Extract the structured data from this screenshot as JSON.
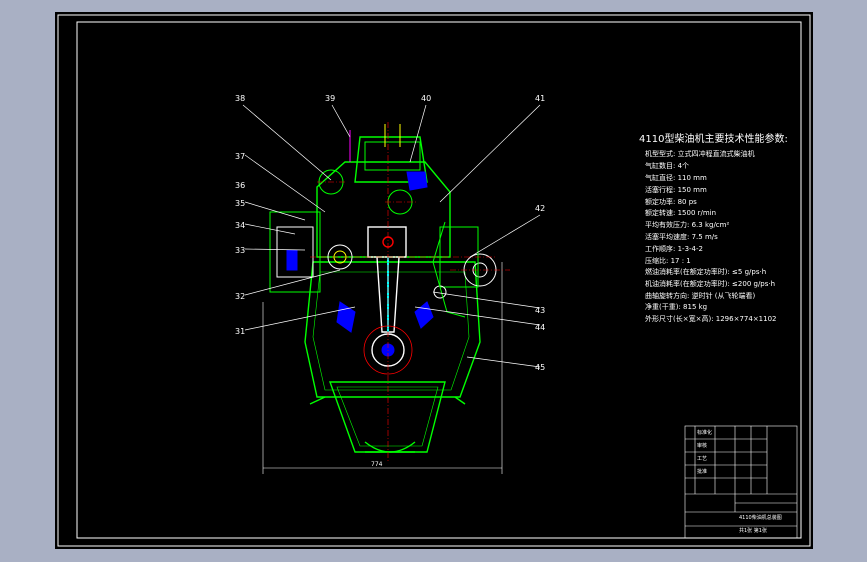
{
  "callouts": [
    "31",
    "32",
    "33",
    "34",
    "35",
    "36",
    "37",
    "38",
    "39",
    "40",
    "41",
    "42",
    "43",
    "44",
    "45"
  ],
  "dimension": "774",
  "specs": {
    "title": "4110型柴油机主要技术性能参数:",
    "rows": [
      "机型型式: 立式四冲程直流式柴油机",
      "气缸数目: 4个",
      "气缸直径: 110 mm",
      "活塞行程: 150 mm",
      "额定功率: 80 ps",
      "额定转速: 1500 r/min",
      "平均有效压力: 6.3 kg/cm²",
      "活塞平均速度: 7.5 m/s",
      "工作顺序: 1-3-4-2",
      "压缩比: 17 : 1",
      "燃油消耗率(在额定功率时): ≤5 g/ps·h",
      "机油消耗率(在额定功率时): ≤200 g/ps·h",
      "曲轴旋转方向: 逆时针 (从飞轮端看)",
      "净重(干重): 815 kg",
      "外形尺寸(长×宽×高): 1296×774×1102"
    ]
  },
  "title_block": {
    "rows": [
      "标准化",
      "审核",
      "工艺",
      "批准"
    ],
    "drawing_name": "4110柴油机总装图",
    "sheet": "共1张 第1张"
  },
  "colors": {
    "sheet": "#000000",
    "frame": "#ffffff",
    "body": "#00ff00",
    "blue": "#0000ff",
    "red": "#ff0000",
    "yellow": "#ffff00",
    "magenta": "#ff00ff",
    "cyan": "#00ffff"
  }
}
